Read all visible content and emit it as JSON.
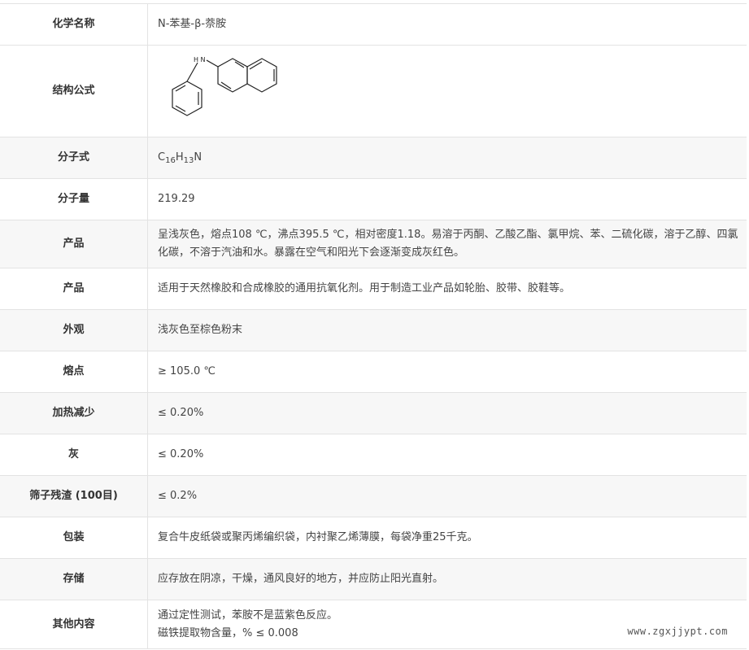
{
  "rows": [
    {
      "label": "化学名称",
      "value": "N-苯基-β-萘胺"
    },
    {
      "label": "结构公式",
      "value": "",
      "structure_atom_label": "H N"
    },
    {
      "label": "分子式",
      "formula": {
        "c": "C",
        "c_sub": "16",
        "h": "H",
        "h_sub": "13",
        "n": "N"
      }
    },
    {
      "label": "分子量",
      "value": "219.29"
    },
    {
      "label": "产品",
      "value": "呈浅灰色，熔点108 ℃，沸点395.5 ℃，相对密度1.18。易溶于丙酮、乙酸乙酯、氯甲烷、苯、二硫化碳，溶于乙醇、四氯化碳，不溶于汽油和水。暴露在空气和阳光下会逐渐变成灰红色。"
    },
    {
      "label": "产品",
      "value": "适用于天然橡胶和合成橡胶的通用抗氧化剂。用于制造工业产品如轮胎、胶带、胶鞋等。"
    },
    {
      "label": "外观",
      "value": "浅灰色至棕色粉末"
    },
    {
      "label": "熔点",
      "value": "≥ 105.0 ℃"
    },
    {
      "label": "加热减少",
      "value": "≤ 0.20%"
    },
    {
      "label": "灰",
      "value": "≤ 0.20%"
    },
    {
      "label": "筛子残渣 (100目)",
      "value": "≤ 0.2%"
    },
    {
      "label": "包装",
      "value": "复合牛皮纸袋或聚丙烯编织袋，内衬聚乙烯薄膜，每袋净重25千克。"
    },
    {
      "label": "存储",
      "value": "应存放在阴凉，干燥，通风良好的地方，并应防止阳光直射。"
    },
    {
      "label": "其他内容",
      "value_line1": "通过定性测试，苯胺不是蓝紫色反应。",
      "value_line2": "磁铁提取物含量，% ≤ 0.008"
    }
  ],
  "watermark": "www.zgxjjypt.com"
}
